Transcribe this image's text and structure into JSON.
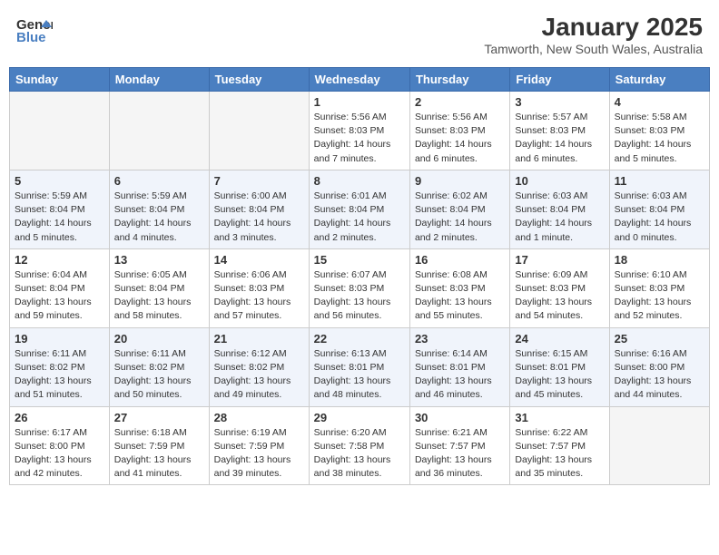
{
  "header": {
    "logo_general": "General",
    "logo_blue": "Blue",
    "title": "January 2025",
    "subtitle": "Tamworth, New South Wales, Australia"
  },
  "days_of_week": [
    "Sunday",
    "Monday",
    "Tuesday",
    "Wednesday",
    "Thursday",
    "Friday",
    "Saturday"
  ],
  "weeks": [
    [
      {
        "day": "",
        "info": ""
      },
      {
        "day": "",
        "info": ""
      },
      {
        "day": "",
        "info": ""
      },
      {
        "day": "1",
        "info": "Sunrise: 5:56 AM\nSunset: 8:03 PM\nDaylight: 14 hours\nand 7 minutes."
      },
      {
        "day": "2",
        "info": "Sunrise: 5:56 AM\nSunset: 8:03 PM\nDaylight: 14 hours\nand 6 minutes."
      },
      {
        "day": "3",
        "info": "Sunrise: 5:57 AM\nSunset: 8:03 PM\nDaylight: 14 hours\nand 6 minutes."
      },
      {
        "day": "4",
        "info": "Sunrise: 5:58 AM\nSunset: 8:03 PM\nDaylight: 14 hours\nand 5 minutes."
      }
    ],
    [
      {
        "day": "5",
        "info": "Sunrise: 5:59 AM\nSunset: 8:04 PM\nDaylight: 14 hours\nand 5 minutes."
      },
      {
        "day": "6",
        "info": "Sunrise: 5:59 AM\nSunset: 8:04 PM\nDaylight: 14 hours\nand 4 minutes."
      },
      {
        "day": "7",
        "info": "Sunrise: 6:00 AM\nSunset: 8:04 PM\nDaylight: 14 hours\nand 3 minutes."
      },
      {
        "day": "8",
        "info": "Sunrise: 6:01 AM\nSunset: 8:04 PM\nDaylight: 14 hours\nand 2 minutes."
      },
      {
        "day": "9",
        "info": "Sunrise: 6:02 AM\nSunset: 8:04 PM\nDaylight: 14 hours\nand 2 minutes."
      },
      {
        "day": "10",
        "info": "Sunrise: 6:03 AM\nSunset: 8:04 PM\nDaylight: 14 hours\nand 1 minute."
      },
      {
        "day": "11",
        "info": "Sunrise: 6:03 AM\nSunset: 8:04 PM\nDaylight: 14 hours\nand 0 minutes."
      }
    ],
    [
      {
        "day": "12",
        "info": "Sunrise: 6:04 AM\nSunset: 8:04 PM\nDaylight: 13 hours\nand 59 minutes."
      },
      {
        "day": "13",
        "info": "Sunrise: 6:05 AM\nSunset: 8:04 PM\nDaylight: 13 hours\nand 58 minutes."
      },
      {
        "day": "14",
        "info": "Sunrise: 6:06 AM\nSunset: 8:03 PM\nDaylight: 13 hours\nand 57 minutes."
      },
      {
        "day": "15",
        "info": "Sunrise: 6:07 AM\nSunset: 8:03 PM\nDaylight: 13 hours\nand 56 minutes."
      },
      {
        "day": "16",
        "info": "Sunrise: 6:08 AM\nSunset: 8:03 PM\nDaylight: 13 hours\nand 55 minutes."
      },
      {
        "day": "17",
        "info": "Sunrise: 6:09 AM\nSunset: 8:03 PM\nDaylight: 13 hours\nand 54 minutes."
      },
      {
        "day": "18",
        "info": "Sunrise: 6:10 AM\nSunset: 8:03 PM\nDaylight: 13 hours\nand 52 minutes."
      }
    ],
    [
      {
        "day": "19",
        "info": "Sunrise: 6:11 AM\nSunset: 8:02 PM\nDaylight: 13 hours\nand 51 minutes."
      },
      {
        "day": "20",
        "info": "Sunrise: 6:11 AM\nSunset: 8:02 PM\nDaylight: 13 hours\nand 50 minutes."
      },
      {
        "day": "21",
        "info": "Sunrise: 6:12 AM\nSunset: 8:02 PM\nDaylight: 13 hours\nand 49 minutes."
      },
      {
        "day": "22",
        "info": "Sunrise: 6:13 AM\nSunset: 8:01 PM\nDaylight: 13 hours\nand 48 minutes."
      },
      {
        "day": "23",
        "info": "Sunrise: 6:14 AM\nSunset: 8:01 PM\nDaylight: 13 hours\nand 46 minutes."
      },
      {
        "day": "24",
        "info": "Sunrise: 6:15 AM\nSunset: 8:01 PM\nDaylight: 13 hours\nand 45 minutes."
      },
      {
        "day": "25",
        "info": "Sunrise: 6:16 AM\nSunset: 8:00 PM\nDaylight: 13 hours\nand 44 minutes."
      }
    ],
    [
      {
        "day": "26",
        "info": "Sunrise: 6:17 AM\nSunset: 8:00 PM\nDaylight: 13 hours\nand 42 minutes."
      },
      {
        "day": "27",
        "info": "Sunrise: 6:18 AM\nSunset: 7:59 PM\nDaylight: 13 hours\nand 41 minutes."
      },
      {
        "day": "28",
        "info": "Sunrise: 6:19 AM\nSunset: 7:59 PM\nDaylight: 13 hours\nand 39 minutes."
      },
      {
        "day": "29",
        "info": "Sunrise: 6:20 AM\nSunset: 7:58 PM\nDaylight: 13 hours\nand 38 minutes."
      },
      {
        "day": "30",
        "info": "Sunrise: 6:21 AM\nSunset: 7:57 PM\nDaylight: 13 hours\nand 36 minutes."
      },
      {
        "day": "31",
        "info": "Sunrise: 6:22 AM\nSunset: 7:57 PM\nDaylight: 13 hours\nand 35 minutes."
      },
      {
        "day": "",
        "info": ""
      }
    ]
  ]
}
